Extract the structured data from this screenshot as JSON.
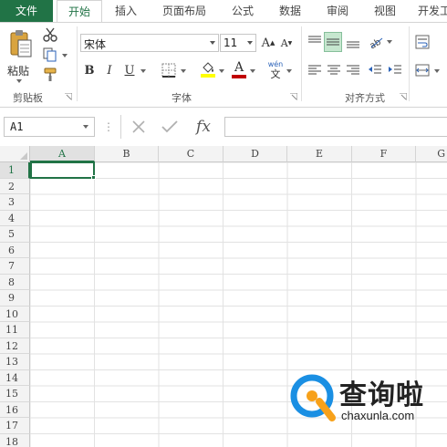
{
  "ribbon": {
    "tabs": [
      {
        "label": "文件"
      },
      {
        "label": "开始"
      },
      {
        "label": "插入"
      },
      {
        "label": "页面布局"
      },
      {
        "label": "公式"
      },
      {
        "label": "数据"
      },
      {
        "label": "审阅"
      },
      {
        "label": "视图"
      },
      {
        "label": "开发工"
      }
    ],
    "active_tab": "开始",
    "clipboard": {
      "paste_label": "粘贴",
      "group_label": "剪贴板"
    },
    "font": {
      "font_name": "宋体",
      "font_size": "11",
      "bold": "B",
      "italic": "I",
      "underline": "U",
      "font_color_glyph": "A",
      "phonetic_top": "wén",
      "phonetic_bottom": "文",
      "group_label": "字体"
    },
    "alignment": {
      "group_label": "对齐方式"
    }
  },
  "formula_bar": {
    "name_box": "A1",
    "fx_label": "fx",
    "formula": ""
  },
  "grid": {
    "columns": [
      "A",
      "B",
      "C",
      "D",
      "E",
      "F",
      "G"
    ],
    "rows": [
      "1",
      "2",
      "3",
      "4",
      "5",
      "6",
      "7",
      "8",
      "9",
      "10",
      "11",
      "12",
      "13",
      "14",
      "15",
      "16",
      "17",
      "18"
    ],
    "selected_cell": "A1"
  },
  "watermark": {
    "title": "查询啦",
    "url": "chaxunla.com"
  },
  "colors": {
    "accent": "#217346",
    "font_color_bar": "#c00000",
    "fill_color_bar": "#ffff00",
    "watermark_blue": "#1a8fe3",
    "watermark_orange": "#f7a11a"
  }
}
